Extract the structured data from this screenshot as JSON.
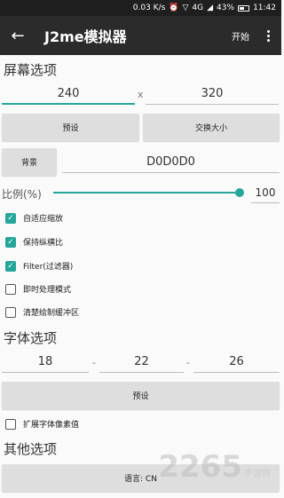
{
  "status_bar": {
    "speed": "0.03 K/s",
    "network": "4G",
    "battery": "43%",
    "time": "11:42"
  },
  "toolbar": {
    "title": "J2me模拟器",
    "start_label": "开始"
  },
  "screen_options": {
    "heading": "屏幕选项",
    "width": "240",
    "separator": "x",
    "height": "320",
    "preset_label": "预设",
    "swap_label": "交换大小",
    "background_label": "背景",
    "background_value": "D0D0D0",
    "scale_label": "比例(%)",
    "scale_value": "100",
    "scale_fraction": 1.0,
    "checkboxes": [
      {
        "label": "自适应缩放",
        "checked": true
      },
      {
        "label": "保持纵横比",
        "checked": true
      },
      {
        "label": "Filter(过滤器)",
        "checked": true
      },
      {
        "label": "即时处理模式",
        "checked": false
      },
      {
        "label": "清楚绘制缓冲区",
        "checked": false
      }
    ]
  },
  "font_options": {
    "heading": "字体选项",
    "sizes": [
      "18",
      "22",
      "26"
    ],
    "separator": "-",
    "preset_label": "预设",
    "extend_label": "扩展字体像素值",
    "extend_checked": false
  },
  "other_options": {
    "heading": "其他选项",
    "language_label": "语言: CN"
  },
  "watermark": {
    "number": "2265",
    "site": "手游网"
  },
  "colors": {
    "accent": "#26a69a",
    "toolbar": "#2b2b2b",
    "statusbar": "#1f1f1f",
    "button": "#dedede"
  }
}
